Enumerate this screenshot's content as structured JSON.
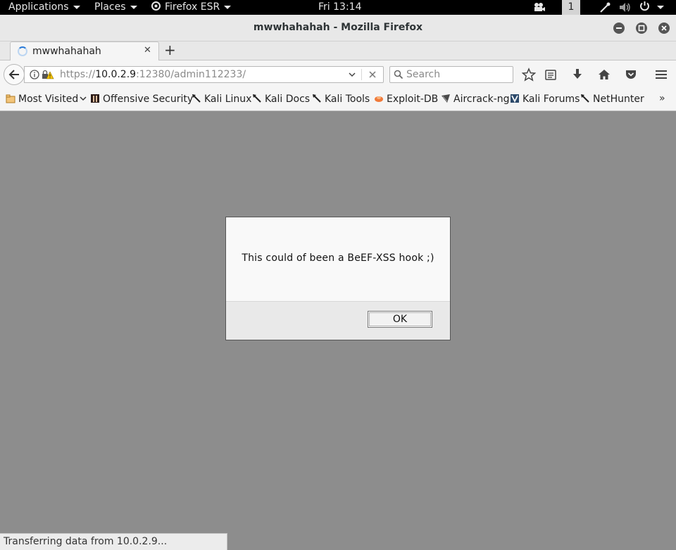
{
  "topbar": {
    "applications": "Applications",
    "places": "Places",
    "firefox": "Firefox ESR",
    "clock": "Fri 13:14",
    "workspace": "1"
  },
  "window": {
    "title": "mwwhahahah - Mozilla Firefox"
  },
  "tab": {
    "label": "mwwhahahah",
    "close": "✕",
    "new_tab": "+"
  },
  "navbar": {
    "url_prefix": "https://",
    "url_host": "10.0.2.9",
    "url_rest": ":12380/admin112233/",
    "search_placeholder": "Search"
  },
  "bookmarks": [
    {
      "label": "Most Visited",
      "icon": "folder-icon"
    },
    {
      "label": "Offensive Security",
      "icon": "offsec-icon"
    },
    {
      "label": "Kali Linux",
      "icon": "kali-dragon-icon"
    },
    {
      "label": "Kali Docs",
      "icon": "kali-dragon-icon"
    },
    {
      "label": "Kali Tools",
      "icon": "kali-dragon-icon"
    },
    {
      "label": "Exploit-DB",
      "icon": "exploitdb-icon"
    },
    {
      "label": "Aircrack-ng",
      "icon": "aircrack-icon"
    },
    {
      "label": "Kali Forums",
      "icon": "kali-forums-icon"
    },
    {
      "label": "NetHunter",
      "icon": "kali-dragon-icon"
    }
  ],
  "dialog": {
    "message": "This could of been a BeEF-XSS hook ;)",
    "ok_label": "OK"
  },
  "status": {
    "text": "Transferring data from 10.0.2.9..."
  },
  "colors": {
    "content_bg": "#8d8d8d",
    "spinner": "#2a7ad8"
  }
}
